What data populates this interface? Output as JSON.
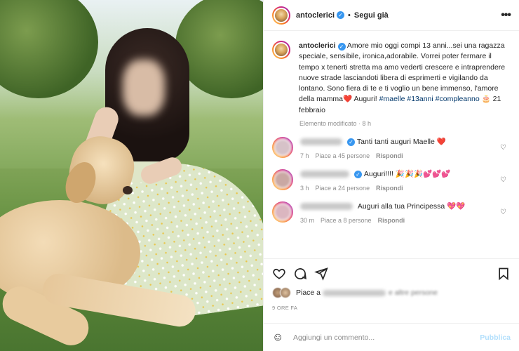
{
  "post": {
    "username": "antoclerici",
    "follow_label": "Segui già",
    "dot": "•",
    "more_label": "•••",
    "verified_glyph": "✓"
  },
  "caption": {
    "username": "antoclerici",
    "text": "Amore mio oggi compi 13 anni...sei una ragazza speciale, sensibile, ironica,adorabile. Vorrei poter fermare il tempo x tenerti stretta ma amo vederti crescere e intraprendere nuove strade lasciandoti libera di esprimerti e vigilando da lontano. Sono fiera di te e ti voglio un bene immenso, l'amore della mamma",
    "heart": "❤️",
    "greeting": "Auguri!",
    "hashtags": [
      "#maelle",
      "#13anni",
      "#compleanno"
    ],
    "cake": "🎂",
    "date": "21 febbraio",
    "meta": "Elemento modificato · 8 h"
  },
  "comments": [
    {
      "text": "Tanti tanti auguri Maelle",
      "emoji": "❤️",
      "time": "7 h",
      "likes": "Piace a 45 persone",
      "reply": "Rispondi",
      "name_width": 60,
      "avatar": "#d6c2c8"
    },
    {
      "text": "Auguri!!!!",
      "emoji": "🎉🎉🎉💕💕💕",
      "time": "3 h",
      "likes": "Piace a 24 persone",
      "reply": "Rispondi",
      "name_width": 70,
      "avatar": "#c9a8a3"
    },
    {
      "text": "Auguri alla tua Principessa",
      "emoji": "💖💖",
      "time": "30 m",
      "likes": "Piace a 8 persone",
      "reply": "Rispondi",
      "name_width": 75,
      "avatar": "#dbb6c0"
    }
  ],
  "actions": {
    "like_icon": "heart-outline",
    "comment_icon": "comment-bubble",
    "share_icon": "paper-plane",
    "save_icon": "bookmark"
  },
  "likes_line": {
    "prefix": "Piace a",
    "suffix": "e altre persone"
  },
  "timestamp": "9 ORE FA",
  "add_comment": {
    "emoji": "☺",
    "placeholder": "Aggiungi un commento...",
    "publish_label": "Pubblica"
  },
  "colors": {
    "accent": "#0095f6",
    "link": "#00376b",
    "muted": "#8e8e8e",
    "publish_disabled": "#b2dffc"
  }
}
